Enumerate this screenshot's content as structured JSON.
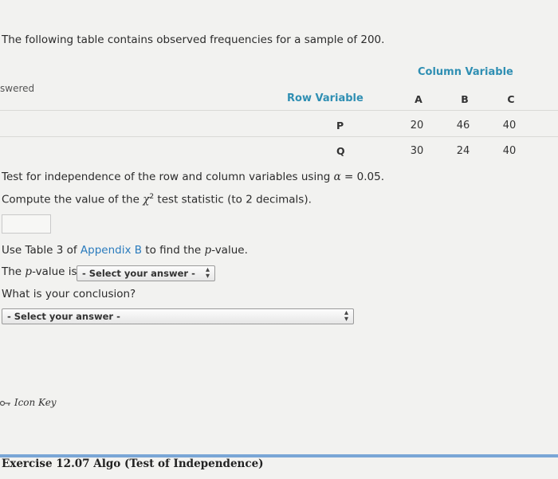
{
  "intro_text": "The following table contains observed frequencies for a sample of 200.",
  "answered_fragment": "swered",
  "table": {
    "column_variable_label": "Column Variable",
    "row_variable_label": "Row Variable",
    "column_headers": [
      "A",
      "B",
      "C"
    ],
    "rows": [
      {
        "label": "P",
        "values": [
          "20",
          "46",
          "40"
        ]
      },
      {
        "label": "Q",
        "values": [
          "30",
          "24",
          "40"
        ]
      }
    ]
  },
  "test_line": {
    "prefix": "Test for independence of the row and column variables using ",
    "alpha_symbol": "α",
    "equals": " = ",
    "alpha_value": "0.05",
    "suffix": "."
  },
  "compute_line": {
    "prefix": "Compute the value of the ",
    "chi": "χ",
    "exponent": "2",
    "suffix": " test statistic (to 2 decimals)."
  },
  "use_table_line": {
    "prefix": "Use Table 3 of ",
    "link": "Appendix B",
    "middle": " to find the ",
    "p_symbol": "p",
    "suffix": "-value."
  },
  "pvalue_line": {
    "prefix": "The ",
    "p_symbol": "p",
    "suffix": "-value is"
  },
  "pvalue_select": "- Select your answer -",
  "conclusion_question": "What is your conclusion?",
  "conclusion_select": "- Select your answer -",
  "icon_key": "Icon Key",
  "footer": "Exercise 12.07 Algo (Test of Independence)"
}
